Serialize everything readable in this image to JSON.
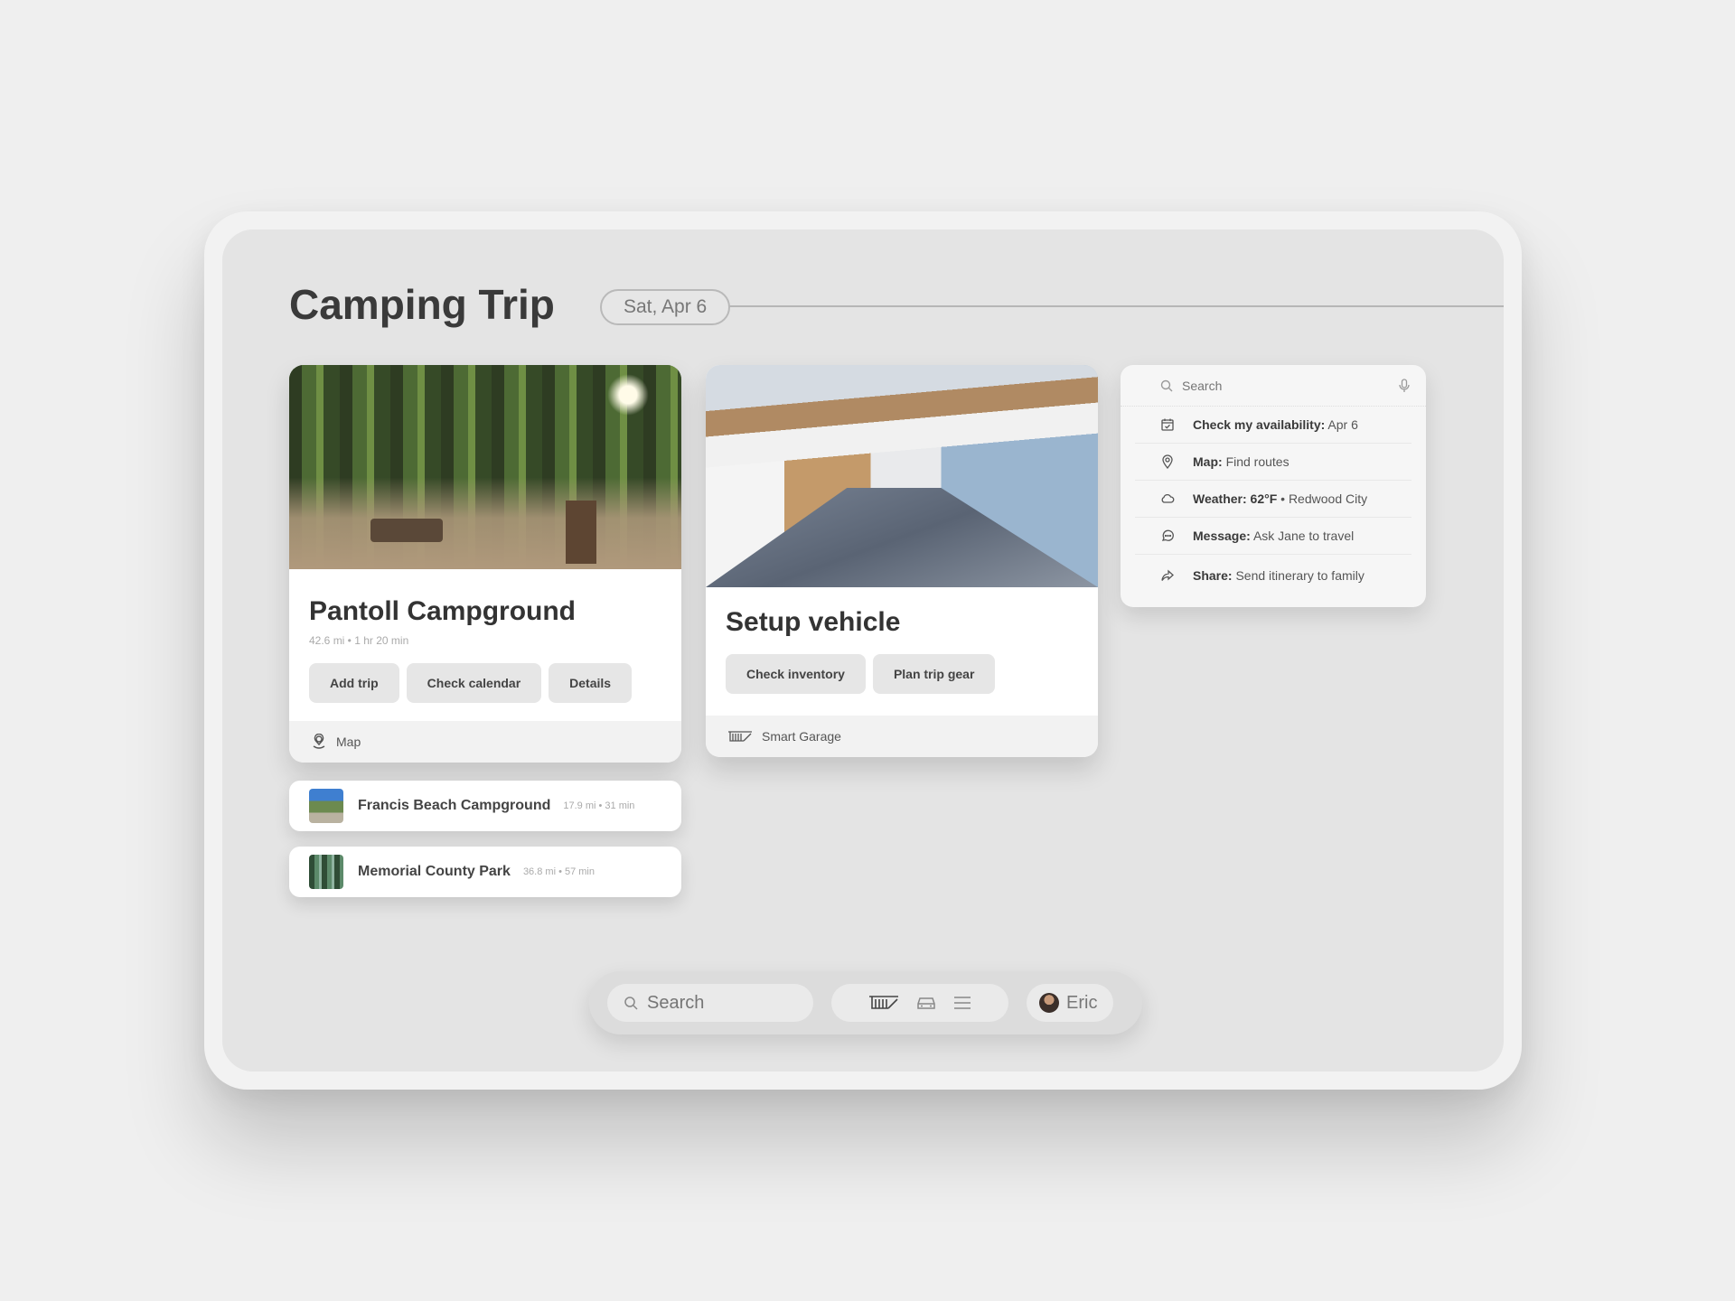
{
  "header": {
    "title": "Camping Trip",
    "date": "Sat, Apr 6"
  },
  "campground_card": {
    "title": "Pantoll Campground",
    "meta": "42.6 mi • 1 hr 20 min",
    "buttons": [
      "Add trip",
      "Check calendar",
      "Details"
    ],
    "footer_icon": "map-pin-icon",
    "footer_label": "Map"
  },
  "alternatives": [
    {
      "name": "Francis Beach Campground",
      "meta": "17.9 mi • 31 min"
    },
    {
      "name": "Memorial County Park",
      "meta": "36.8 mi • 57 min"
    }
  ],
  "vehicle_card": {
    "title": "Setup vehicle",
    "buttons": [
      "Check inventory",
      "Plan trip gear"
    ],
    "footer_icon": "garage-icon",
    "footer_label": "Smart Garage"
  },
  "assistant": {
    "search_placeholder": "Search",
    "suggestions": [
      {
        "icon": "calendar-check-icon",
        "label": "Check my availability:",
        "detail": "Apr 6"
      },
      {
        "icon": "location-pin-icon",
        "label": "Map:",
        "detail": "Find routes"
      },
      {
        "icon": "cloud-icon",
        "label": "Weather: 62°F",
        "detail": "• Redwood City"
      },
      {
        "icon": "message-icon",
        "label": "Message:",
        "detail": "Ask Jane to travel"
      },
      {
        "icon": "share-icon",
        "label": "Share:",
        "detail": "Send itinerary to family"
      }
    ]
  },
  "dock": {
    "search_placeholder": "Search",
    "icons": [
      "garage-icon",
      "car-icon",
      "menu-icon"
    ],
    "user_name": "Eric"
  }
}
